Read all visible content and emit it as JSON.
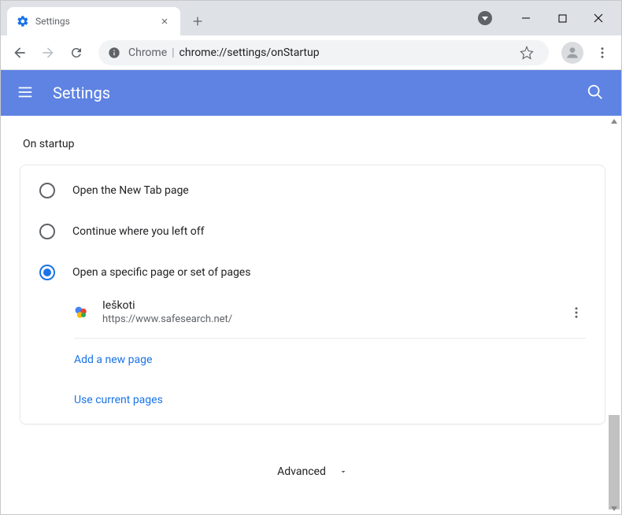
{
  "window": {
    "tab_title": "Settings"
  },
  "omnibox": {
    "label": "Chrome",
    "path": "chrome://settings/onStartup"
  },
  "header": {
    "title": "Settings"
  },
  "section": {
    "title": "On startup"
  },
  "radios": {
    "newtab": "Open the New Tab page",
    "continue": "Continue where you left off",
    "specific": "Open a specific page or set of pages"
  },
  "pages": [
    {
      "name": "Ieškoti",
      "url": "https://www.safesearch.net/"
    }
  ],
  "links": {
    "add_page": "Add a new page",
    "use_current": "Use current pages"
  },
  "advanced": {
    "label": "Advanced"
  },
  "colors": {
    "header_blue": "#5e83e3",
    "link_blue": "#1a73e8"
  }
}
